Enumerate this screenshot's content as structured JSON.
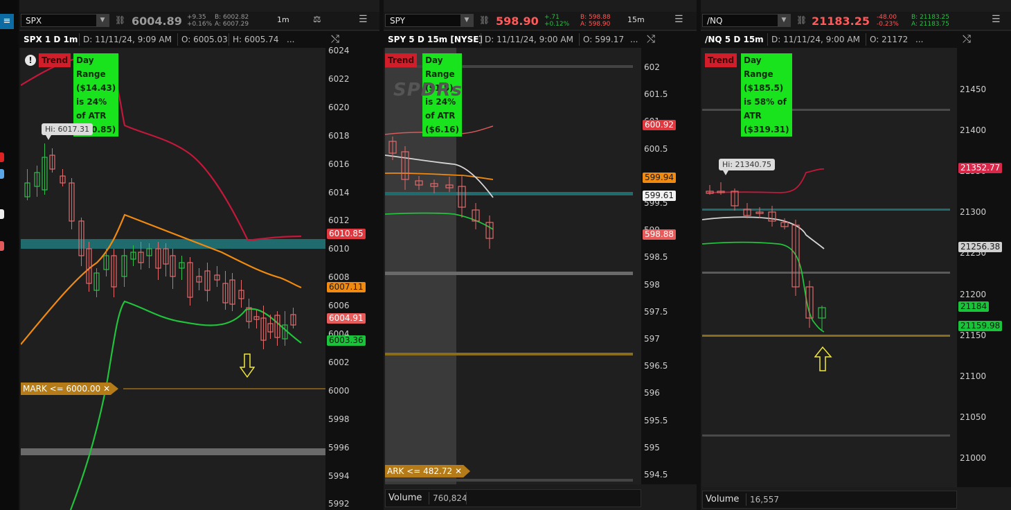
{
  "left_strip": {
    "menu_icon": "hamburger-icon"
  },
  "panels": [
    {
      "id": "spx",
      "symbol": "SPX",
      "last": "6004.89",
      "last_color": "#9a9a9a",
      "change": "+9.35",
      "change_pct": "+0.16%",
      "bid": "B: 6002.82",
      "ask": "A: 6007.29",
      "timeframe": "1m",
      "info_title": "SPX 1 D 1m",
      "info_date": "D: 11/11/24, 9:09 AM",
      "info_open": "O: 6005.03",
      "info_high": "H: 6005.74",
      "info_more": "...",
      "trend_label": "Trend",
      "day_range": "Day Range ($14.43) is 24% of ATR ($60.85)",
      "hi_label": "Hi: 6017.31",
      "mark_label": "MARK <= 6000.00",
      "ticks": [
        "6024",
        "6022",
        "6020",
        "6018",
        "6016",
        "6014",
        "6012",
        "6010",
        "6008",
        "6006",
        "6004",
        "6002",
        "6000",
        "5998",
        "5996",
        "5994",
        "5992"
      ],
      "tags": [
        {
          "text": "6010.85",
          "bg": "#e0383e",
          "fg": "#ffffff"
        },
        {
          "text": "6007.11",
          "bg": "#f08a10",
          "fg": "#1a1a1a"
        },
        {
          "text": "6004.91",
          "bg": "#e85b5b",
          "fg": "#ffffff"
        },
        {
          "text": "6003.36",
          "bg": "#19c43a",
          "fg": "#0b1f0b"
        }
      ]
    },
    {
      "id": "spy",
      "symbol": "SPY",
      "last": "598.90",
      "last_color": "#ff5a5a",
      "change": "+.71",
      "change_pct": "+0.12%",
      "bid": "B: 598.88",
      "ask": "A: 598.90",
      "timeframe": "15m",
      "info_title": "SPY 5 D 15m [NYSE]",
      "info_date": "D: 11/11/24, 9:00 AM",
      "info_open": "O: 599.17",
      "info_more": "...",
      "trend_label": "Trend",
      "day_range": "Day Range ($1.5) is 24% of ATR ($6.16)",
      "watermark": "SPDRs",
      "mark_label": "ARK <= 482.72",
      "ticks": [
        "602",
        "601.5",
        "601",
        "600.5",
        "600",
        "599.5",
        "599",
        "598.5",
        "598",
        "597.5",
        "597",
        "596.5",
        "596",
        "595.5",
        "595",
        "594.5"
      ],
      "tags": [
        {
          "text": "600.92",
          "bg": "#e0383e",
          "fg": "#ffffff"
        },
        {
          "text": "599.94",
          "bg": "#f08a10",
          "fg": "#1a1a1a"
        },
        {
          "text": "599.61",
          "bg": "#f2f2f2",
          "fg": "#1a1a1a"
        },
        {
          "text": "598.88",
          "bg": "#e85b5b",
          "fg": "#ffffff"
        }
      ],
      "volume_label": "Volume",
      "volume_value": "760,824"
    },
    {
      "id": "nq",
      "symbol": "/NQ",
      "last": "21183.25",
      "last_color": "#ff5a5a",
      "change": "-48.00",
      "change_pct": "-0.23%",
      "bid": "B: 21183.25",
      "ask": "A: 21183.75",
      "info_title": "/NQ 5 D 15m",
      "info_date": "D: 11/11/24, 9:00 AM",
      "info_open": "O: 21172",
      "info_more": "...",
      "trend_label": "Trend",
      "day_range": "Day Range ($185.5) is 58% of ATR ($319.31)",
      "hi_label": "Hi: 21340.75",
      "ticks": [
        "21450",
        "21400",
        "21350",
        "21300",
        "21250",
        "21200",
        "21150",
        "21100",
        "21050",
        "21000"
      ],
      "tags": [
        {
          "text": "21352.77",
          "bg": "#d8284a",
          "fg": "#ffffff"
        },
        {
          "text": "21256.38",
          "bg": "#cfcfcf",
          "fg": "#1a1a1a"
        },
        {
          "text": "21184",
          "bg": "#19c43a",
          "fg": "#0b1f0b"
        },
        {
          "text": "21159.98",
          "bg": "#19c43a",
          "fg": "#0b1f0b"
        }
      ],
      "volume_label": "Volume",
      "volume_value": "16,557"
    }
  ],
  "colors": {
    "up": "#2fbf4a",
    "down": "#e36a6a",
    "atr_upper": "#c2183a",
    "ema": "#f08a10",
    "lower": "#21c23c",
    "cyan_band": "#1f6b6e",
    "gray_band": "#6a6a6a",
    "mark_line": "#b47b18"
  }
}
